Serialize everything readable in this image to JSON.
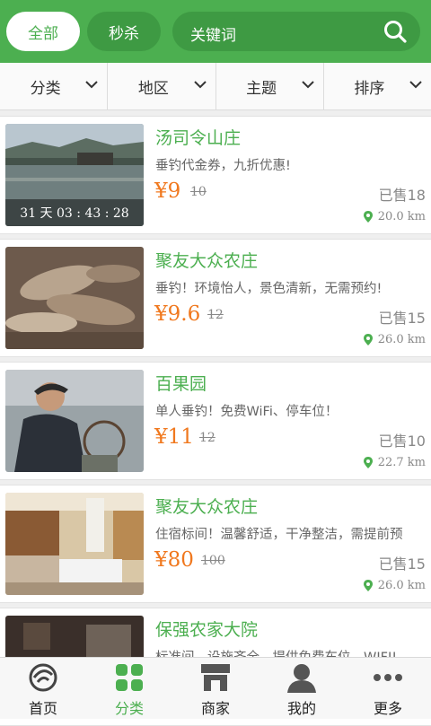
{
  "top": {
    "tab_all": "全部",
    "tab_flash": "秒杀",
    "search_placeholder": "关键词"
  },
  "filters": [
    {
      "label": "分类"
    },
    {
      "label": "地区"
    },
    {
      "label": "主题"
    },
    {
      "label": "排序"
    }
  ],
  "items": [
    {
      "title": "汤司令山庄",
      "desc": "垂钓代金券，九折优惠!",
      "price": "¥9",
      "orig": "10",
      "sold": "已售18",
      "distance": "20.0 km",
      "countdown": "31 天 03 : 43 : 28"
    },
    {
      "title": "聚友大众农庄",
      "desc": "垂钓！环境怡人，景色清新，无需预约!",
      "price": "¥9.6",
      "orig": "12",
      "sold": "已售15",
      "distance": "26.0 km"
    },
    {
      "title": "百果园",
      "desc": "单人垂钓！免费WiFi、停车位！",
      "price": "¥11",
      "orig": "12",
      "sold": "已售10",
      "distance": "22.7 km"
    },
    {
      "title": "聚友大众农庄",
      "desc": "住宿标间！温馨舒适，干净整洁，需提前预",
      "price": "¥80",
      "orig": "100",
      "sold": "已售15",
      "distance": "26.0 km"
    },
    {
      "title": "保强农家大院",
      "desc": "标准间，设施齐全，提供免费车位，WIFI!"
    }
  ],
  "nav": [
    {
      "label": "首页"
    },
    {
      "label": "分类"
    },
    {
      "label": "商家"
    },
    {
      "label": "我的"
    },
    {
      "label": "更多"
    }
  ],
  "colors": {
    "brand": "#4caf50",
    "price": "#f0781e"
  }
}
